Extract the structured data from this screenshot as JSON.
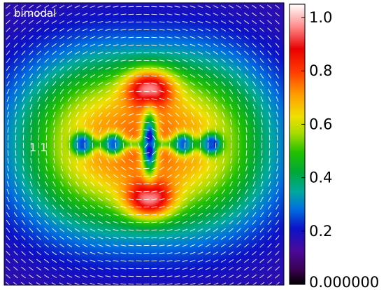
{
  "chart_data": {
    "type": "heatmap",
    "title": "",
    "panel_label": "bimodal",
    "inset_label": "1  1",
    "grid": false,
    "xlabel": "",
    "ylabel": "",
    "colorbar": {
      "range": [
        0.0,
        1.05
      ],
      "ticks": [
        {
          "value": 1.0,
          "label": "1.0"
        },
        {
          "value": 0.8,
          "label": "0.8"
        },
        {
          "value": 0.6,
          "label": "0.6"
        },
        {
          "value": 0.4,
          "label": "0.4"
        },
        {
          "value": 0.2,
          "label": "0.2"
        },
        {
          "value": 0.0,
          "label": "0.000000"
        }
      ],
      "colormap": [
        {
          "v": 0.0,
          "color": "#000000"
        },
        {
          "v": 0.05,
          "color": "#3a0050"
        },
        {
          "v": 0.12,
          "color": "#4a0a9a"
        },
        {
          "v": 0.2,
          "color": "#0c12c8"
        },
        {
          "v": 0.27,
          "color": "#0070e0"
        },
        {
          "v": 0.33,
          "color": "#00a8a0"
        },
        {
          "v": 0.4,
          "color": "#00a838"
        },
        {
          "v": 0.47,
          "color": "#20c000"
        },
        {
          "v": 0.54,
          "color": "#a8dc00"
        },
        {
          "v": 0.6,
          "color": "#f0e000"
        },
        {
          "v": 0.68,
          "color": "#ff9a00"
        },
        {
          "v": 0.76,
          "color": "#ff3a00"
        },
        {
          "v": 0.84,
          "color": "#ea0000"
        },
        {
          "v": 0.92,
          "color": "#ff8a8a"
        },
        {
          "v": 1.0,
          "color": "#ffffff"
        }
      ]
    },
    "field": {
      "description_key": "bimodal",
      "background_level": 0.15,
      "peaks": [
        {
          "x": 0.52,
          "y": 0.3,
          "value": 1.0
        },
        {
          "x": 0.52,
          "y": 0.7,
          "value": 1.0
        }
      ],
      "minima": [
        {
          "x": 0.28,
          "y": 0.5,
          "value": 0.12
        },
        {
          "x": 0.39,
          "y": 0.5,
          "value": 0.15
        },
        {
          "x": 0.52,
          "y": 0.5,
          "value": 0.1
        },
        {
          "x": 0.64,
          "y": 0.5,
          "value": 0.15
        },
        {
          "x": 0.74,
          "y": 0.5,
          "value": 0.12
        }
      ]
    },
    "vectors": {
      "color": "#ffffff",
      "description": "polarization direction segments"
    }
  }
}
